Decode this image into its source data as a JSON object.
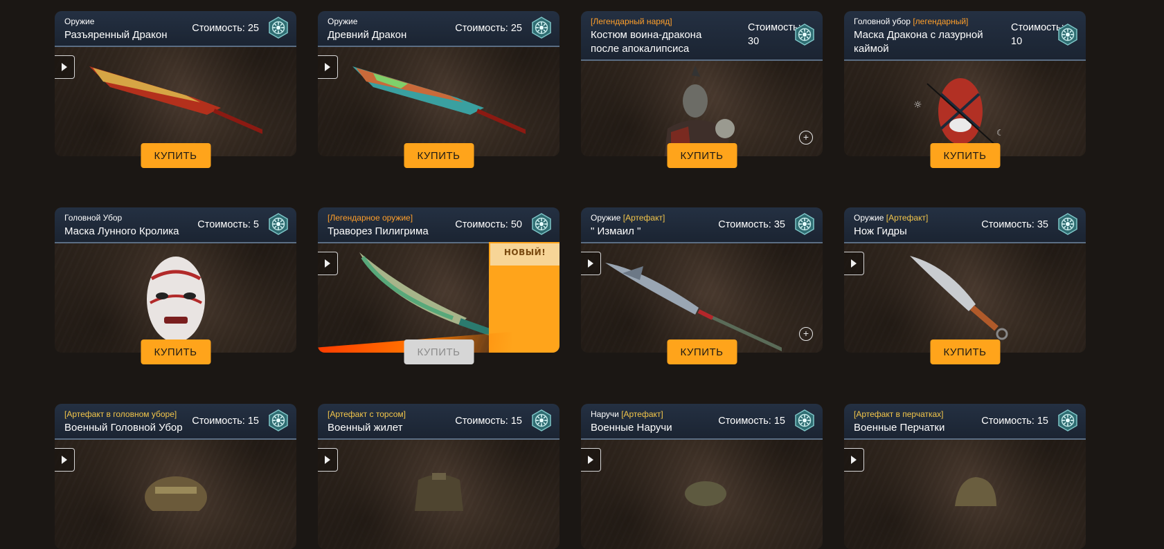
{
  "buy_label": "КУПИТЬ",
  "new_label": "НОВЫЙ!",
  "colors": {
    "accent": "#ffa41b",
    "legendary": "#ff9f2a",
    "artifact": "#f3c64a",
    "header": "#243042"
  },
  "cards": [
    {
      "cat": "Оружие",
      "tag": "",
      "name": "Разъяренный Дракон",
      "cost": "Стоимость: 25"
    },
    {
      "cat": "Оружие",
      "tag": "",
      "name": "Древний Дракон",
      "cost": "Стоимость: 25"
    },
    {
      "cat": "",
      "tag": "[Легендарный наряд]",
      "name": "Костюм воина-дракона после апокалипсиса",
      "cost": "Стоимость: 30"
    },
    {
      "cat": "Головной убор",
      "tag": "[легендарный]",
      "name": "Маска Дракона с лазурной каймой",
      "cost": "Стоимость: 10"
    },
    {
      "cat": "Головной Убор",
      "tag": "",
      "name": "Маска Лунного Кролика",
      "cost": "Стоимость: 5"
    },
    {
      "cat": "",
      "tag": "[Легендарное оружие]",
      "name": "Траворез Пилигрима",
      "cost": "Стоимость: 50"
    },
    {
      "cat": "Оружие",
      "tag": "[Артефакт]",
      "name": "\" Измаил \"",
      "cost": "Стоимость: 35"
    },
    {
      "cat": "Оружие",
      "tag": "[Артефакт]",
      "name": "Нож Гидры",
      "cost": "Стоимость: 35"
    },
    {
      "cat": "",
      "tag": "[Артефакт в головном уборе]",
      "name": "Военный Головной Убор",
      "cost": "Стоимость: 15"
    },
    {
      "cat": "",
      "tag": "[Артефакт с торсом]",
      "name": "Военный жилет",
      "cost": "Стоимость: 15"
    },
    {
      "cat": "Наручи",
      "tag": "[Артефакт]",
      "name": "Военные Наручи",
      "cost": "Стоимость: 15"
    },
    {
      "cat": "",
      "tag": "[Артефакт в перчатках]",
      "name": "Военные Перчатки",
      "cost": "Стоимость: 15"
    }
  ]
}
